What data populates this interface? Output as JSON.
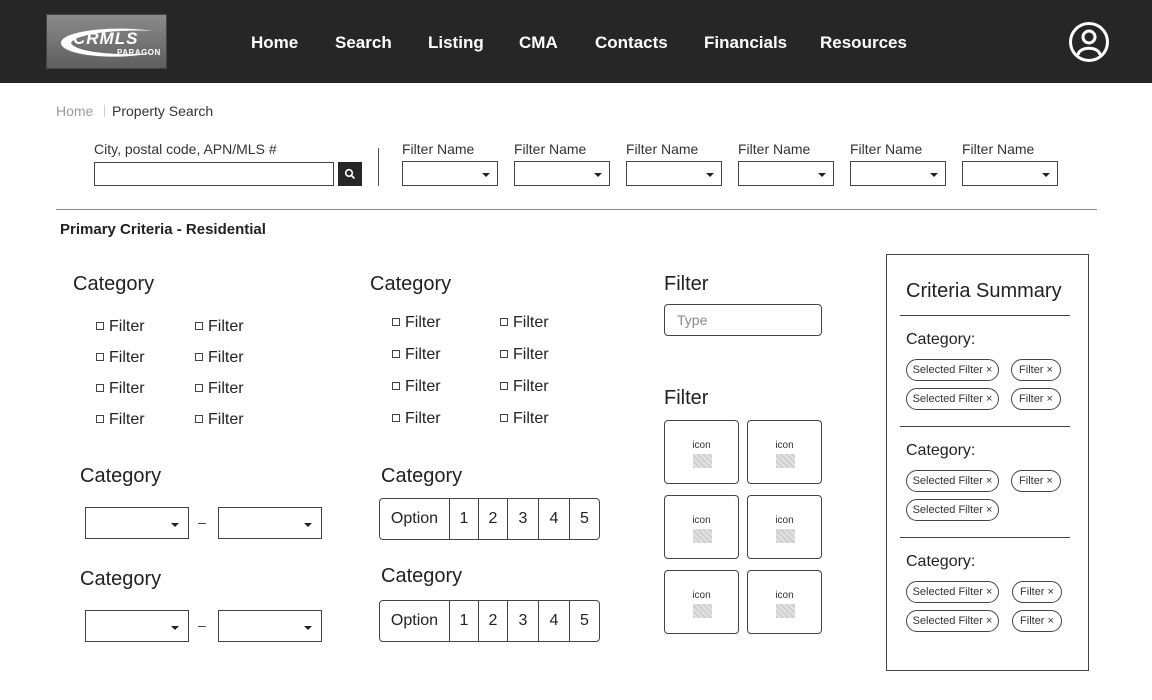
{
  "header": {
    "logo": {
      "text": "CRMLS",
      "sub": "PARAGON"
    },
    "nav": [
      "Home",
      "Search",
      "Listing",
      "CMA",
      "Contacts",
      "Financials",
      "Resources"
    ],
    "user_icon": "user-circle-icon"
  },
  "breadcrumb": {
    "home": "Home",
    "current": "Property Search"
  },
  "search": {
    "label": "City, postal code, APN/MLS #",
    "value": "",
    "icon": "search-icon"
  },
  "top_filters": [
    "Filter Name",
    "Filter Name",
    "Filter Name",
    "Filter Name",
    "Filter Name",
    "Filter Name"
  ],
  "section_title": "Primary Criteria - Residential",
  "checkbox_groups": [
    {
      "title": "Category",
      "items": [
        "Filter",
        "Filter",
        "Filter",
        "Filter",
        "Filter",
        "Filter",
        "Filter",
        "Filter"
      ]
    },
    {
      "title": "Category",
      "items": [
        "Filter",
        "Filter",
        "Filter",
        "Filter",
        "Filter",
        "Filter",
        "Filter",
        "Filter"
      ]
    }
  ],
  "range_groups": [
    {
      "title": "Category",
      "separator": "–"
    },
    {
      "title": "Category",
      "separator": "–"
    }
  ],
  "segmented_groups": [
    {
      "title": "Category",
      "options": [
        "Option",
        "1",
        "2",
        "3",
        "4",
        "5"
      ]
    },
    {
      "title": "Category",
      "options": [
        "Option",
        "1",
        "2",
        "3",
        "4",
        "5"
      ]
    }
  ],
  "text_filter": {
    "title": "Filter",
    "placeholder": "Type"
  },
  "icon_filter": {
    "title": "Filter",
    "tiles": [
      "icon",
      "icon",
      "icon",
      "icon",
      "icon",
      "icon"
    ]
  },
  "summary": {
    "title": "Criteria Summary",
    "groups": [
      {
        "label": "Category:",
        "chips": [
          "Selected Filter ×",
          "Filter ×",
          "Selected Filter ×",
          "Filter ×"
        ]
      },
      {
        "label": "Category:",
        "chips": [
          "Selected Filter ×",
          "Filter ×",
          "Selected Filter ×"
        ]
      },
      {
        "label": "Category:",
        "chips": [
          "Selected Filter ×",
          "Filter ×",
          "Selected Filter ×",
          "Filter ×"
        ]
      }
    ]
  }
}
